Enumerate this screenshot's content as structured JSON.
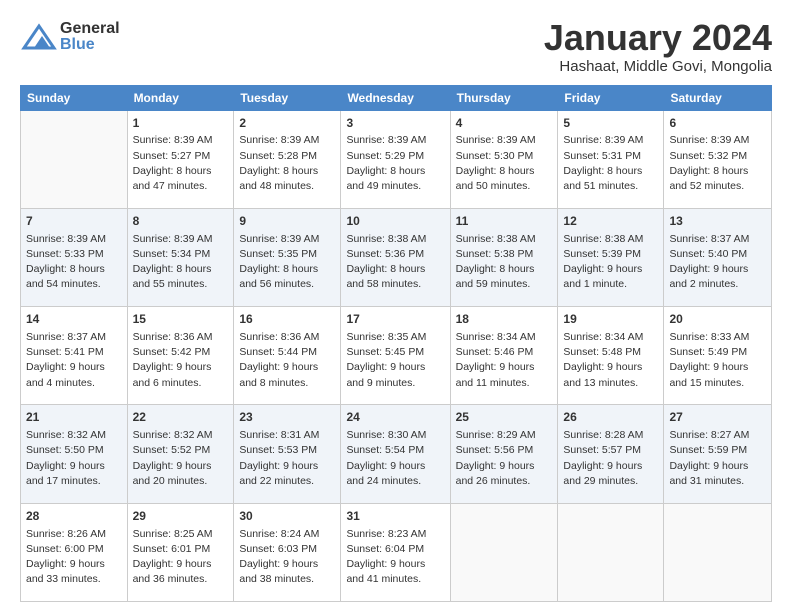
{
  "header": {
    "logo": {
      "general": "General",
      "blue": "Blue"
    },
    "title": "January 2024",
    "location": "Hashaat, Middle Govi, Mongolia"
  },
  "days_of_week": [
    "Sunday",
    "Monday",
    "Tuesday",
    "Wednesday",
    "Thursday",
    "Friday",
    "Saturday"
  ],
  "weeks": [
    [
      {
        "num": "",
        "content": ""
      },
      {
        "num": "1",
        "content": "Sunrise: 8:39 AM\nSunset: 5:27 PM\nDaylight: 8 hours\nand 47 minutes."
      },
      {
        "num": "2",
        "content": "Sunrise: 8:39 AM\nSunset: 5:28 PM\nDaylight: 8 hours\nand 48 minutes."
      },
      {
        "num": "3",
        "content": "Sunrise: 8:39 AM\nSunset: 5:29 PM\nDaylight: 8 hours\nand 49 minutes."
      },
      {
        "num": "4",
        "content": "Sunrise: 8:39 AM\nSunset: 5:30 PM\nDaylight: 8 hours\nand 50 minutes."
      },
      {
        "num": "5",
        "content": "Sunrise: 8:39 AM\nSunset: 5:31 PM\nDaylight: 8 hours\nand 51 minutes."
      },
      {
        "num": "6",
        "content": "Sunrise: 8:39 AM\nSunset: 5:32 PM\nDaylight: 8 hours\nand 52 minutes."
      }
    ],
    [
      {
        "num": "7",
        "content": "Sunrise: 8:39 AM\nSunset: 5:33 PM\nDaylight: 8 hours\nand 54 minutes."
      },
      {
        "num": "8",
        "content": "Sunrise: 8:39 AM\nSunset: 5:34 PM\nDaylight: 8 hours\nand 55 minutes."
      },
      {
        "num": "9",
        "content": "Sunrise: 8:39 AM\nSunset: 5:35 PM\nDaylight: 8 hours\nand 56 minutes."
      },
      {
        "num": "10",
        "content": "Sunrise: 8:38 AM\nSunset: 5:36 PM\nDaylight: 8 hours\nand 58 minutes."
      },
      {
        "num": "11",
        "content": "Sunrise: 8:38 AM\nSunset: 5:38 PM\nDaylight: 8 hours\nand 59 minutes."
      },
      {
        "num": "12",
        "content": "Sunrise: 8:38 AM\nSunset: 5:39 PM\nDaylight: 9 hours\nand 1 minute."
      },
      {
        "num": "13",
        "content": "Sunrise: 8:37 AM\nSunset: 5:40 PM\nDaylight: 9 hours\nand 2 minutes."
      }
    ],
    [
      {
        "num": "14",
        "content": "Sunrise: 8:37 AM\nSunset: 5:41 PM\nDaylight: 9 hours\nand 4 minutes."
      },
      {
        "num": "15",
        "content": "Sunrise: 8:36 AM\nSunset: 5:42 PM\nDaylight: 9 hours\nand 6 minutes."
      },
      {
        "num": "16",
        "content": "Sunrise: 8:36 AM\nSunset: 5:44 PM\nDaylight: 9 hours\nand 8 minutes."
      },
      {
        "num": "17",
        "content": "Sunrise: 8:35 AM\nSunset: 5:45 PM\nDaylight: 9 hours\nand 9 minutes."
      },
      {
        "num": "18",
        "content": "Sunrise: 8:34 AM\nSunset: 5:46 PM\nDaylight: 9 hours\nand 11 minutes."
      },
      {
        "num": "19",
        "content": "Sunrise: 8:34 AM\nSunset: 5:48 PM\nDaylight: 9 hours\nand 13 minutes."
      },
      {
        "num": "20",
        "content": "Sunrise: 8:33 AM\nSunset: 5:49 PM\nDaylight: 9 hours\nand 15 minutes."
      }
    ],
    [
      {
        "num": "21",
        "content": "Sunrise: 8:32 AM\nSunset: 5:50 PM\nDaylight: 9 hours\nand 17 minutes."
      },
      {
        "num": "22",
        "content": "Sunrise: 8:32 AM\nSunset: 5:52 PM\nDaylight: 9 hours\nand 20 minutes."
      },
      {
        "num": "23",
        "content": "Sunrise: 8:31 AM\nSunset: 5:53 PM\nDaylight: 9 hours\nand 22 minutes."
      },
      {
        "num": "24",
        "content": "Sunrise: 8:30 AM\nSunset: 5:54 PM\nDaylight: 9 hours\nand 24 minutes."
      },
      {
        "num": "25",
        "content": "Sunrise: 8:29 AM\nSunset: 5:56 PM\nDaylight: 9 hours\nand 26 minutes."
      },
      {
        "num": "26",
        "content": "Sunrise: 8:28 AM\nSunset: 5:57 PM\nDaylight: 9 hours\nand 29 minutes."
      },
      {
        "num": "27",
        "content": "Sunrise: 8:27 AM\nSunset: 5:59 PM\nDaylight: 9 hours\nand 31 minutes."
      }
    ],
    [
      {
        "num": "28",
        "content": "Sunrise: 8:26 AM\nSunset: 6:00 PM\nDaylight: 9 hours\nand 33 minutes."
      },
      {
        "num": "29",
        "content": "Sunrise: 8:25 AM\nSunset: 6:01 PM\nDaylight: 9 hours\nand 36 minutes."
      },
      {
        "num": "30",
        "content": "Sunrise: 8:24 AM\nSunset: 6:03 PM\nDaylight: 9 hours\nand 38 minutes."
      },
      {
        "num": "31",
        "content": "Sunrise: 8:23 AM\nSunset: 6:04 PM\nDaylight: 9 hours\nand 41 minutes."
      },
      {
        "num": "",
        "content": ""
      },
      {
        "num": "",
        "content": ""
      },
      {
        "num": "",
        "content": ""
      }
    ]
  ]
}
